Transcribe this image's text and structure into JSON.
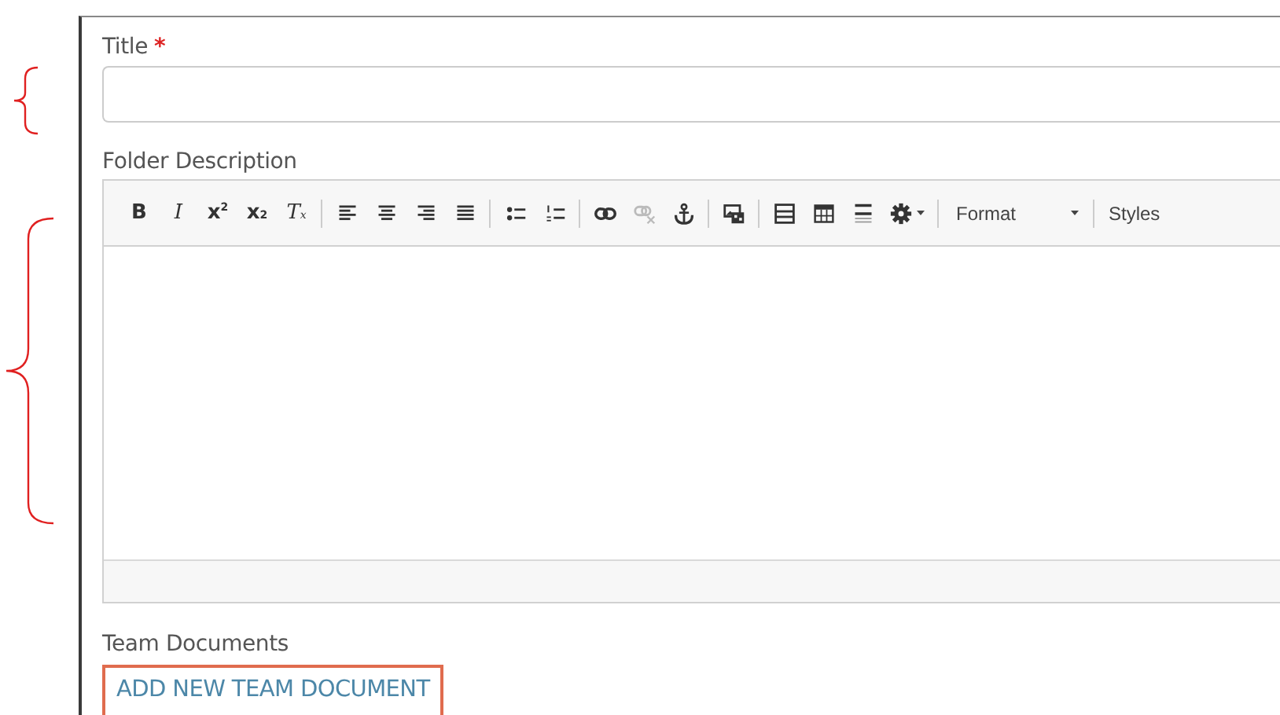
{
  "title_field": {
    "label": "Title",
    "required_mark": "*"
  },
  "description": {
    "label": "Folder Description",
    "toolbar": [
      [
        {
          "kind": "bold-glyph",
          "text": "B",
          "disabled": false
        },
        {
          "kind": "italic-glyph",
          "text": "I",
          "disabled": false
        },
        {
          "kind": "glyph",
          "text": "x$^{2}$",
          "disabled": false
        },
        {
          "kind": "glyph",
          "text": "x$_{2}$",
          "disabled": false
        },
        {
          "kind": "italic-glyph",
          "text": "T$_{x}$",
          "disabled": false
        }
      ],
      [
        {
          "kind": "align-left",
          "disabled": false
        },
        {
          "kind": "align-center",
          "disabled": false
        },
        {
          "kind": "align-right",
          "disabled": false
        },
        {
          "kind": "justify",
          "disabled": false
        }
      ],
      [
        {
          "kind": "bullets",
          "disabled": false
        },
        {
          "kind": "numbers",
          "disabled": false
        }
      ],
      [
        {
          "kind": "link",
          "disabled": false
        },
        {
          "kind": "unlink",
          "disabled": true
        },
        {
          "kind": "anchor",
          "disabled": false
        }
      ],
      [
        {
          "kind": "image",
          "disabled": false
        }
      ],
      [
        {
          "kind": "block",
          "disabled": false
        },
        {
          "kind": "table",
          "disabled": false
        },
        {
          "kind": "rule",
          "disabled": false
        },
        {
          "kind": "gear",
          "disabled": false
        }
      ],
      [
        {
          "kind": "dropdown",
          "text": "Format"
        }
      ],
      [
        {
          "kind": "plain",
          "text": "Styles"
        }
      ]
    ]
  },
  "team_documents": {
    "label": "Team Documents",
    "button": "ADD NEW TEAM DOCUMENT"
  }
}
